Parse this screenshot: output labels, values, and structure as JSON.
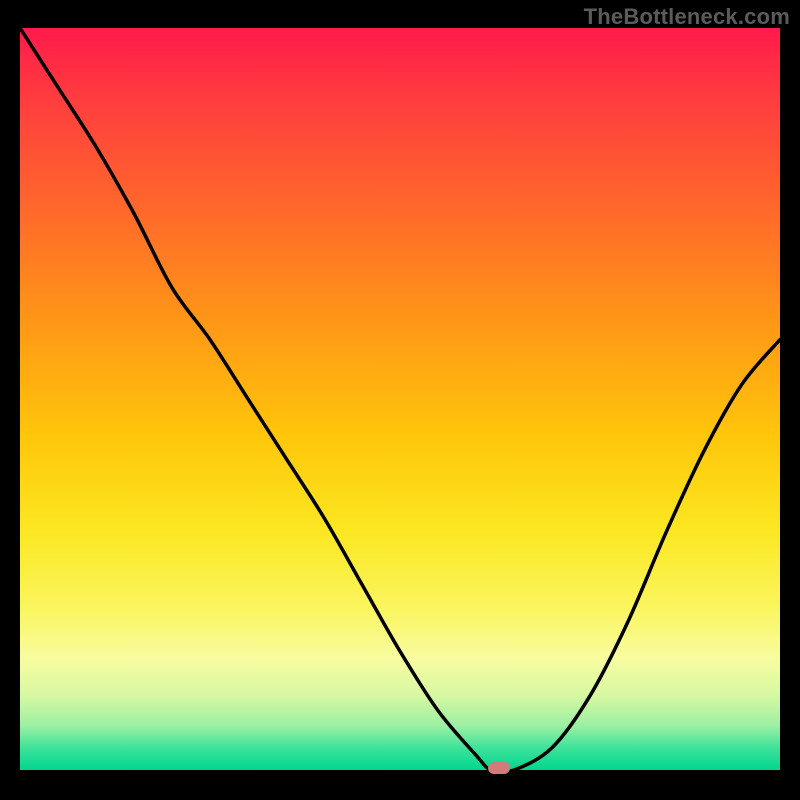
{
  "watermark": "TheBottleneck.com",
  "colors": {
    "background": "#000000",
    "watermark": "#5b5b5b",
    "curve": "#000000",
    "marker": "#d47a7a",
    "gradient_top": "#ff1a4b",
    "gradient_bottom": "#00d68f"
  },
  "chart_data": {
    "type": "line",
    "title": "",
    "xlabel": "",
    "ylabel": "",
    "xlim": [
      0,
      100
    ],
    "ylim": [
      0,
      100
    ],
    "grid": false,
    "legend": false,
    "series": [
      {
        "name": "bottleneck-curve",
        "x": [
          0,
          5,
          10,
          15,
          20,
          25,
          30,
          35,
          40,
          45,
          50,
          55,
          60,
          62,
          65,
          70,
          75,
          80,
          85,
          90,
          95,
          100
        ],
        "y": [
          100,
          92,
          84,
          75,
          65,
          58,
          50,
          42,
          34,
          25,
          16,
          8,
          2,
          0,
          0,
          3,
          10,
          20,
          32,
          43,
          52,
          58
        ]
      }
    ],
    "annotations": [
      {
        "name": "optimal-marker",
        "x": 63,
        "y": 0
      }
    ]
  }
}
